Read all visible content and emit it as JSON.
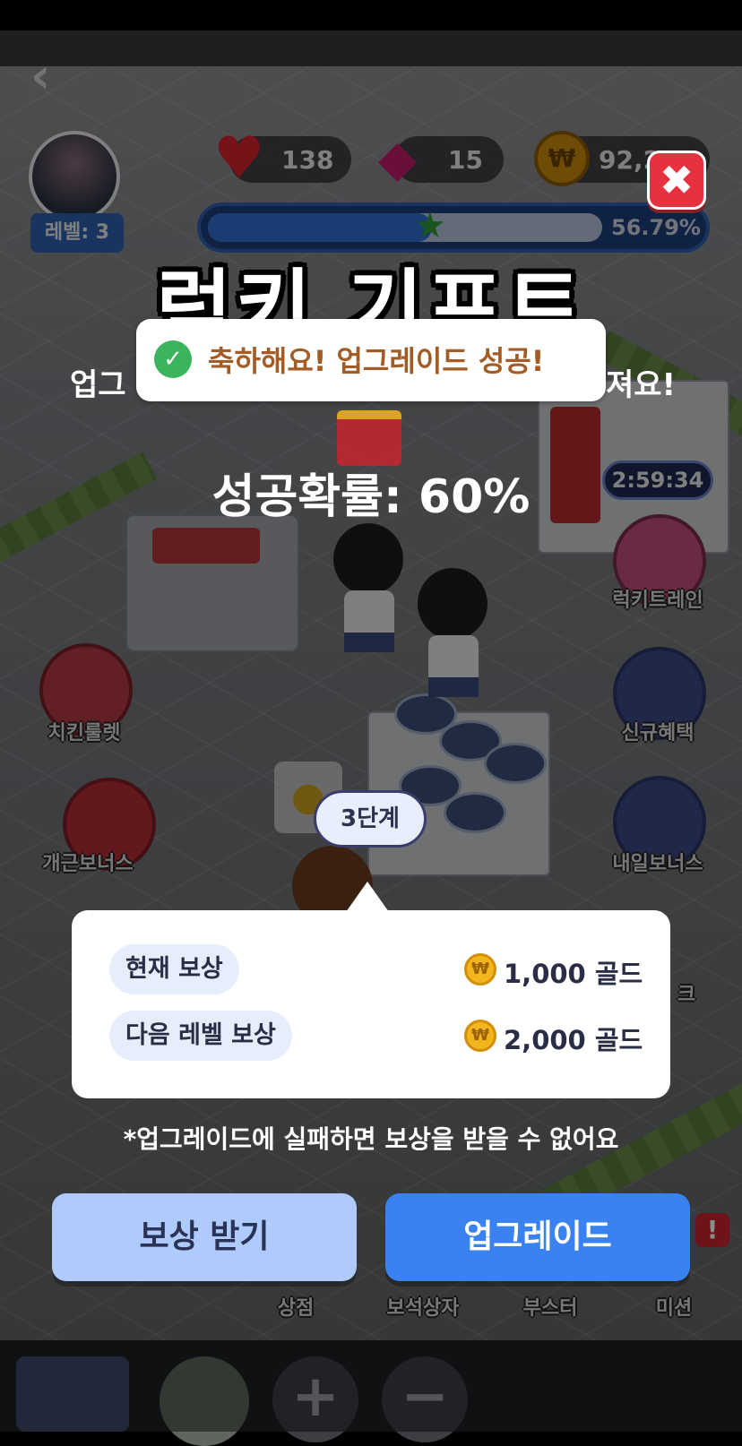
{
  "hud": {
    "hearts": "138",
    "gems": "15",
    "gold": "92,2",
    "level": "레벨: 3",
    "progress_text": "56.79%",
    "progress_fraction": 0.5679
  },
  "side_menu": {
    "left": [
      "치킨룰렛",
      "개근보너스"
    ],
    "right": [
      "럭키트레인",
      "신규혜택",
      "내일보너스",
      "크"
    ],
    "timer": "2:59:34"
  },
  "bottom_menu": [
    "상점",
    "보석상자",
    "부스터",
    "미션"
  ],
  "popup": {
    "title": "럭키 기프트",
    "toast": "축하해요! 업그레이드 성공!",
    "desc_left": "업그",
    "desc_right": "져요!",
    "success_rate": "성공확률: 60%",
    "stage": "3단계",
    "current_reward_label": "현재 보상",
    "current_reward_value": "1,000 골드",
    "next_reward_label": "다음 레벨 보상",
    "next_reward_value": "2,000 골드",
    "coin_symbol": "₩",
    "note": "*업그레이드에 실패하면 보상을 받을 수 없어요",
    "claim_button": "보상 받기",
    "upgrade_button": "업그레이드"
  },
  "colors": {
    "upgrade_button": "#3a82f0",
    "claim_button": "#aecbfb",
    "close_button": "#e8313f",
    "toast_text": "#a35c26"
  }
}
